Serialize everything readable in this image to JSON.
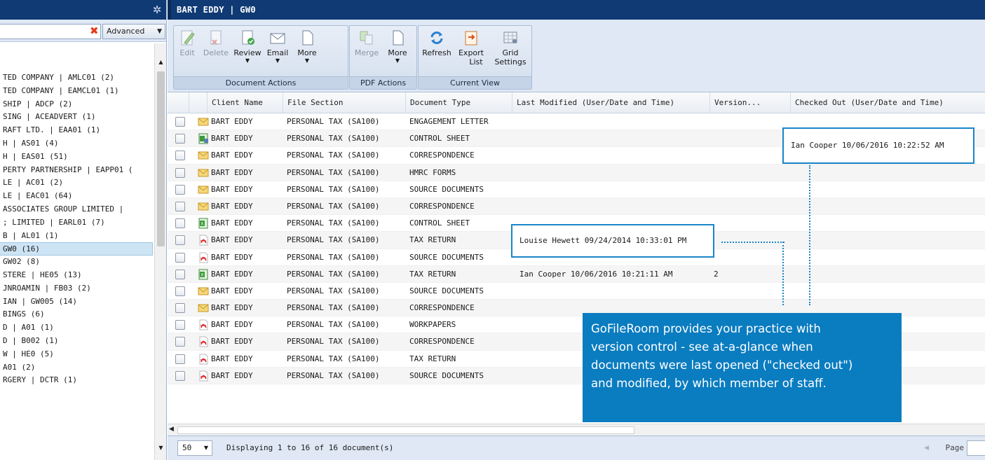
{
  "left_panel": {
    "advanced_label": "Advanced",
    "tree_items": [
      "TED COMPANY | AMLC01 (2)",
      "TED COMPANY | EAMCL01 (1)",
      "SHIP | ADCP (2)",
      "SING | ACEADVERT (1)",
      "RAFT LTD. | EAA01 (1)",
      "H | AS01 (4)",
      "H | EAS01 (51)",
      "PERTY PARTNERSHIP | EAPP01 (",
      "LE | AC01 (2)",
      "LE | EAC01 (64)",
      "ASSOCIATES GROUP LIMITED |",
      "; LIMITED | EARL01 (7)",
      "B | AL01 (1)",
      "GW0 (16)",
      " GW02 (8)",
      "STERE | HE05 (13)",
      "JNROAMIN | FB03 (2)",
      "IAN | GW005 (14)",
      " BINGS (6)",
      "D | A01 (1)",
      "D | B002 (1)",
      "W | HE0 (5)",
      "A01 (2)",
      "RGERY | DCTR (1)"
    ],
    "selected_index": 13
  },
  "main": {
    "title": "BART EDDY | GW0",
    "ribbon": {
      "groups": {
        "document_actions": "Document Actions",
        "pdf_actions": "PDF Actions",
        "current_view": "Current View"
      },
      "buttons": {
        "edit": "Edit",
        "delete": "Delete",
        "review": "Review",
        "email": "Email",
        "more_doc": "More",
        "merge": "Merge",
        "more_pdf": "More",
        "refresh": "Refresh",
        "export_line1": "Export",
        "export_line2": "List",
        "grid_line1": "Grid",
        "grid_line2": "Settings"
      }
    },
    "columns": {
      "client_name": "Client Name",
      "file_section": "File Section",
      "document_type": "Document Type",
      "last_modified": "Last Modified (User/Date and Time)",
      "version": "Version...",
      "checked_out": "Checked Out (User/Date and Time)"
    },
    "rows": [
      {
        "icon": "email",
        "client": "BART EDDY",
        "section": "PERSONAL TAX (SA100)",
        "doc_type": "ENGAGEMENT LETTER",
        "last_modified": "",
        "version": "",
        "checked_out": ""
      },
      {
        "icon": "excel-locked",
        "client": "BART EDDY",
        "section": "PERSONAL TAX (SA100)",
        "doc_type": "CONTROL SHEET",
        "last_modified": "",
        "version": "",
        "checked_out": ""
      },
      {
        "icon": "email",
        "client": "BART EDDY",
        "section": "PERSONAL TAX (SA100)",
        "doc_type": "CORRESPONDENCE",
        "last_modified": "",
        "version": "",
        "checked_out": ""
      },
      {
        "icon": "email",
        "client": "BART EDDY",
        "section": "PERSONAL TAX (SA100)",
        "doc_type": "HMRC FORMS",
        "last_modified": "",
        "version": "",
        "checked_out": ""
      },
      {
        "icon": "email",
        "client": "BART EDDY",
        "section": "PERSONAL TAX (SA100)",
        "doc_type": "SOURCE DOCUMENTS",
        "last_modified": "",
        "version": "",
        "checked_out": ""
      },
      {
        "icon": "email",
        "client": "BART EDDY",
        "section": "PERSONAL TAX (SA100)",
        "doc_type": "CORRESPONDENCE",
        "last_modified": "",
        "version": "",
        "checked_out": ""
      },
      {
        "icon": "excel",
        "client": "BART EDDY",
        "section": "PERSONAL TAX (SA100)",
        "doc_type": "CONTROL SHEET",
        "last_modified": "",
        "version": "",
        "checked_out": ""
      },
      {
        "icon": "pdf",
        "client": "BART EDDY",
        "section": "PERSONAL TAX (SA100)",
        "doc_type": "TAX RETURN",
        "last_modified": "",
        "version": "",
        "checked_out": ""
      },
      {
        "icon": "pdf",
        "client": "BART EDDY",
        "section": "PERSONAL TAX (SA100)",
        "doc_type": "SOURCE DOCUMENTS",
        "last_modified": "",
        "version": "",
        "checked_out": ""
      },
      {
        "icon": "excel",
        "client": "BART EDDY",
        "section": "PERSONAL TAX (SA100)",
        "doc_type": "TAX RETURN",
        "last_modified": "Ian Cooper 10/06/2016 10:21:11 AM",
        "version": "2",
        "checked_out": ""
      },
      {
        "icon": "email",
        "client": "BART EDDY",
        "section": "PERSONAL TAX (SA100)",
        "doc_type": "SOURCE DOCUMENTS",
        "last_modified": "",
        "version": "",
        "checked_out": ""
      },
      {
        "icon": "email",
        "client": "BART EDDY",
        "section": "PERSONAL TAX (SA100)",
        "doc_type": "CORRESPONDENCE",
        "last_modified": "",
        "version": "",
        "checked_out": ""
      },
      {
        "icon": "pdf",
        "client": "BART EDDY",
        "section": "PERSONAL TAX (SA100)",
        "doc_type": "WORKPAPERS",
        "last_modified": "",
        "version": "",
        "checked_out": ""
      },
      {
        "icon": "pdf",
        "client": "BART EDDY",
        "section": "PERSONAL TAX (SA100)",
        "doc_type": "CORRESPONDENCE",
        "last_modified": "",
        "version": "",
        "checked_out": ""
      },
      {
        "icon": "pdf",
        "client": "BART EDDY",
        "section": "PERSONAL TAX (SA100)",
        "doc_type": "TAX RETURN",
        "last_modified": "",
        "version": "",
        "checked_out": ""
      },
      {
        "icon": "pdf",
        "client": "BART EDDY",
        "section": "PERSONAL TAX (SA100)",
        "doc_type": "SOURCE DOCUMENTS",
        "last_modified": "",
        "version": "",
        "checked_out": ""
      }
    ],
    "callouts": {
      "checked_out": "Ian Cooper 10/06/2016 10:22:52 AM",
      "last_modified": "Louise Hewett 09/24/2014 10:33:01 PM"
    },
    "info_box_lines": [
      "GoFileRoom provides your practice with",
      "version control - see at-a-glance when",
      "documents were last opened (\"checked out\")",
      "and modified, by which member of staff."
    ],
    "pager": {
      "page_size": "50",
      "display_text": "Displaying 1 to 16 of 16 document(s)",
      "page_label": "Page"
    }
  },
  "colors": {
    "header_navy": "#0f3a74",
    "ribbon_bg": "#dfe8f4",
    "callout_blue": "#1985c8",
    "info_box_blue": "#0a7cc0",
    "selected_row": "#cde4f5"
  }
}
